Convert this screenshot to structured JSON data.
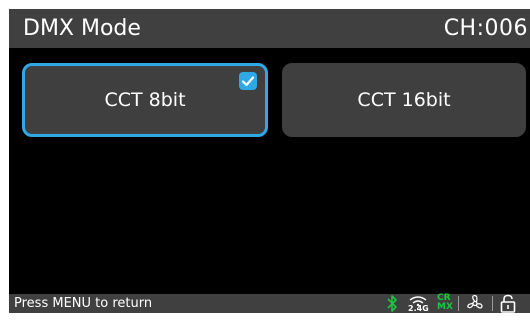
{
  "header": {
    "title": "DMX Mode",
    "channel": "CH:006"
  },
  "options": [
    {
      "label": "CCT 8bit",
      "selected": true
    },
    {
      "label": "CCT 16bit",
      "selected": false
    }
  ],
  "footer": {
    "hint": "Press MENU to return",
    "band_label": "2.4G",
    "crmx_line1": "CR",
    "crmx_line2": "MX"
  },
  "icons": [
    "bluetooth-icon",
    "wifi-2-4g-icon",
    "crmx-icon",
    "fan-icon",
    "lock-icon"
  ],
  "colors": {
    "accent": "#2fa9e6",
    "crmx_green": "#19c83c",
    "bar_gray": "#404040",
    "button_gray": "#3f3f3f"
  }
}
